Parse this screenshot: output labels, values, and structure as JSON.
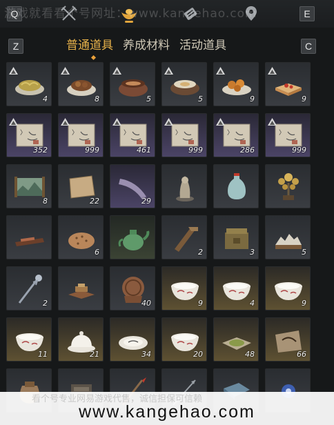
{
  "top_nav": {
    "left_key": "Q",
    "right_key": "E",
    "icons": [
      "crossed-swords-icon",
      "ingot-icon",
      "scroll-icon",
      "map-pin-icon"
    ]
  },
  "watermark_top": "游戏就看看个号网址：www.kangehao.com",
  "tabs": {
    "left_key": "Z",
    "right_key": "C",
    "items": [
      {
        "label": "普通道具",
        "active": true
      },
      {
        "label": "养成材料",
        "active": false
      },
      {
        "label": "活动道具",
        "active": false
      }
    ]
  },
  "items": [
    {
      "icon": "fried-noodles-icon",
      "quality": "grey",
      "count": "4",
      "badge": true
    },
    {
      "icon": "braised-meat-icon",
      "quality": "grey",
      "count": "8",
      "badge": true
    },
    {
      "icon": "stew-pot-icon",
      "quality": "grey",
      "count": "5",
      "badge": true
    },
    {
      "icon": "soup-bowl-icon",
      "quality": "grey",
      "count": "5",
      "badge": true
    },
    {
      "icon": "fried-snack-icon",
      "quality": "grey",
      "count": "9",
      "badge": true
    },
    {
      "icon": "cake-icon",
      "quality": "grey",
      "count": "9",
      "badge": true
    },
    {
      "icon": "note-paper-icon",
      "quality": "purple",
      "count": "352",
      "badge": true
    },
    {
      "icon": "note-paper-icon",
      "quality": "purple",
      "count": "999",
      "badge": true
    },
    {
      "icon": "note-paper-icon",
      "quality": "purple",
      "count": "461",
      "badge": true
    },
    {
      "icon": "note-paper-icon",
      "quality": "purple",
      "count": "999",
      "badge": true
    },
    {
      "icon": "note-paper-icon",
      "quality": "purple",
      "count": "286",
      "badge": true
    },
    {
      "icon": "note-paper-icon",
      "quality": "purple",
      "count": "999",
      "badge": true
    },
    {
      "icon": "landscape-scroll-icon",
      "quality": "grey",
      "count": "8",
      "badge": false
    },
    {
      "icon": "paper-sheet-icon",
      "quality": "grey",
      "count": "22",
      "badge": false
    },
    {
      "icon": "horn-icon",
      "quality": "purple",
      "count": "29",
      "badge": false
    },
    {
      "icon": "statue-icon",
      "quality": "grey",
      "count": "",
      "badge": false
    },
    {
      "icon": "vase-icon",
      "quality": "grey",
      "count": "",
      "badge": false
    },
    {
      "icon": "bonsai-tree-icon",
      "quality": "grey",
      "count": "",
      "badge": false
    },
    {
      "icon": "tray-icon",
      "quality": "grey",
      "count": "",
      "badge": false
    },
    {
      "icon": "flatbread-icon",
      "quality": "grey",
      "count": "6",
      "badge": false
    },
    {
      "icon": "jade-teapot-icon",
      "quality": "green",
      "count": "",
      "badge": false
    },
    {
      "icon": "wooden-tool-icon",
      "quality": "grey",
      "count": "2",
      "badge": false
    },
    {
      "icon": "bronze-box-icon",
      "quality": "grey",
      "count": "3",
      "badge": false
    },
    {
      "icon": "mini-mountain-icon",
      "quality": "grey",
      "count": "5",
      "badge": false
    },
    {
      "icon": "ornate-staff-icon",
      "quality": "grey",
      "count": "2",
      "badge": false
    },
    {
      "icon": "wooden-stand-icon",
      "quality": "grey",
      "count": "",
      "badge": false
    },
    {
      "icon": "carved-comb-icon",
      "quality": "grey",
      "count": "40",
      "badge": false
    },
    {
      "icon": "porcelain-bowl-icon",
      "quality": "gold",
      "count": "9",
      "badge": false
    },
    {
      "icon": "porcelain-bowl-icon",
      "quality": "gold",
      "count": "4",
      "badge": false
    },
    {
      "icon": "porcelain-bowl-icon",
      "quality": "gold",
      "count": "9",
      "badge": false
    },
    {
      "icon": "porcelain-bowl-icon",
      "quality": "gold",
      "count": "11",
      "badge": false
    },
    {
      "icon": "lidded-bowl-icon",
      "quality": "gold",
      "count": "21",
      "badge": false
    },
    {
      "icon": "dish-plate-icon",
      "quality": "gold",
      "count": "34",
      "badge": false
    },
    {
      "icon": "porcelain-bowl-icon",
      "quality": "gold",
      "count": "20",
      "badge": false
    },
    {
      "icon": "herb-powder-icon",
      "quality": "gold",
      "count": "48",
      "badge": false
    },
    {
      "icon": "cloth-wrap-icon",
      "quality": "gold",
      "count": "66",
      "badge": false
    },
    {
      "icon": "pouch-icon",
      "quality": "grey",
      "count": "",
      "badge": false
    },
    {
      "icon": "misc-item-icon",
      "quality": "grey",
      "count": "",
      "badge": false
    },
    {
      "icon": "brush-icon",
      "quality": "grey",
      "count": "",
      "badge": false
    },
    {
      "icon": "arrow-icon",
      "quality": "grey",
      "count": "",
      "badge": false
    },
    {
      "icon": "book-icon",
      "quality": "grey",
      "count": "",
      "badge": false
    },
    {
      "icon": "blue-flower-icon",
      "quality": "grey",
      "count": "",
      "badge": false
    }
  ],
  "watermark_bottom": {
    "chinese": "看个号专业网易游戏代售，诚信担保可信赖",
    "url": "www.kangehao.com"
  },
  "colors": {
    "accent": "#e8b24a",
    "background": "#161819"
  }
}
